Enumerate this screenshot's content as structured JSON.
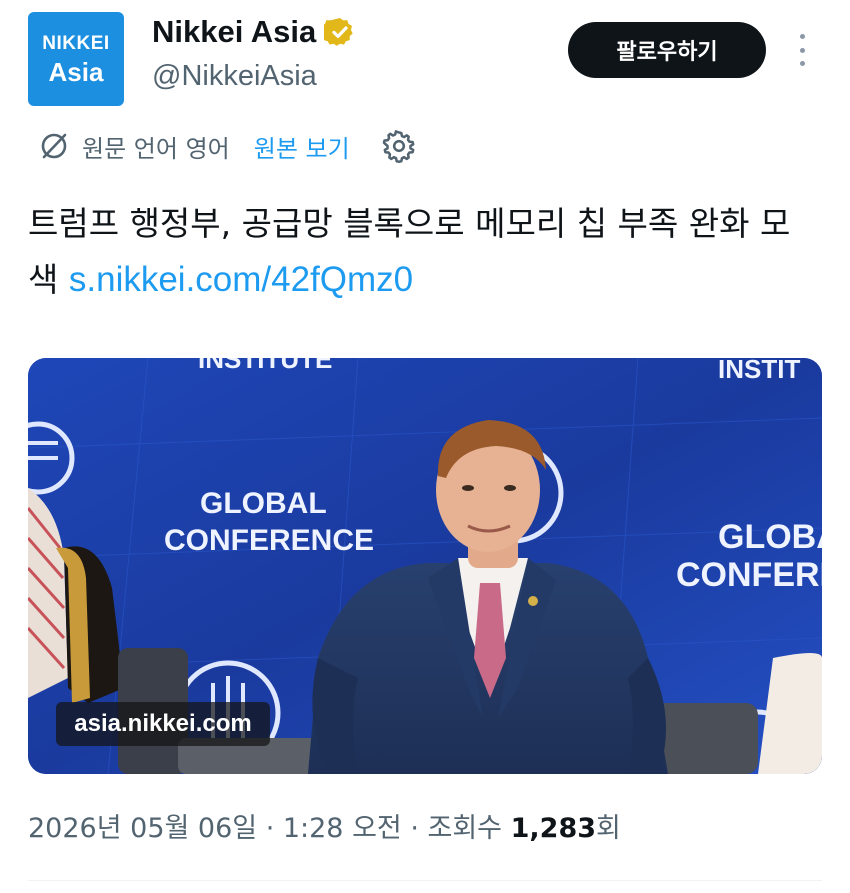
{
  "account": {
    "avatar_line1": "NIKKEI",
    "avatar_line2": "Asia",
    "name": "Nikkei Asia",
    "handle": "@NikkeiAsia",
    "verified_color": "#e2b719"
  },
  "actions": {
    "follow_label": "팔로우하기",
    "more_icon": "more-vertical-icon"
  },
  "translation": {
    "original_language_label": "원문 언어 영어",
    "view_original_label": "원본 보기",
    "icon": "translate-off-icon",
    "settings_icon": "gear-icon"
  },
  "tweet": {
    "text": "트럼프 행정부, 공급망 블록으로 메모리 칩 부족 완화 모색",
    "link": "s.nikkei.com/42fQmz0"
  },
  "media": {
    "watermark": "asia.nikkei.com",
    "backdrop_top_left": "INSTITUTE",
    "backdrop_top_right": "INSTIT",
    "backdrop_left_line1": "GLOBAL",
    "backdrop_left_line2": "CONFERENCE",
    "backdrop_right_line1": "GLOBA",
    "backdrop_right_line2": "CONFEREN"
  },
  "meta": {
    "timestamp": "2026년 05월 06일 · 1:28 오전 · 조회수 ",
    "views": "1,283",
    "views_suffix": "회"
  },
  "colors": {
    "link": "#1d9bf0",
    "secondary_text": "#536471",
    "avatar_bg": "#1d8fe0",
    "stage_blue": "#1a3fa8"
  }
}
